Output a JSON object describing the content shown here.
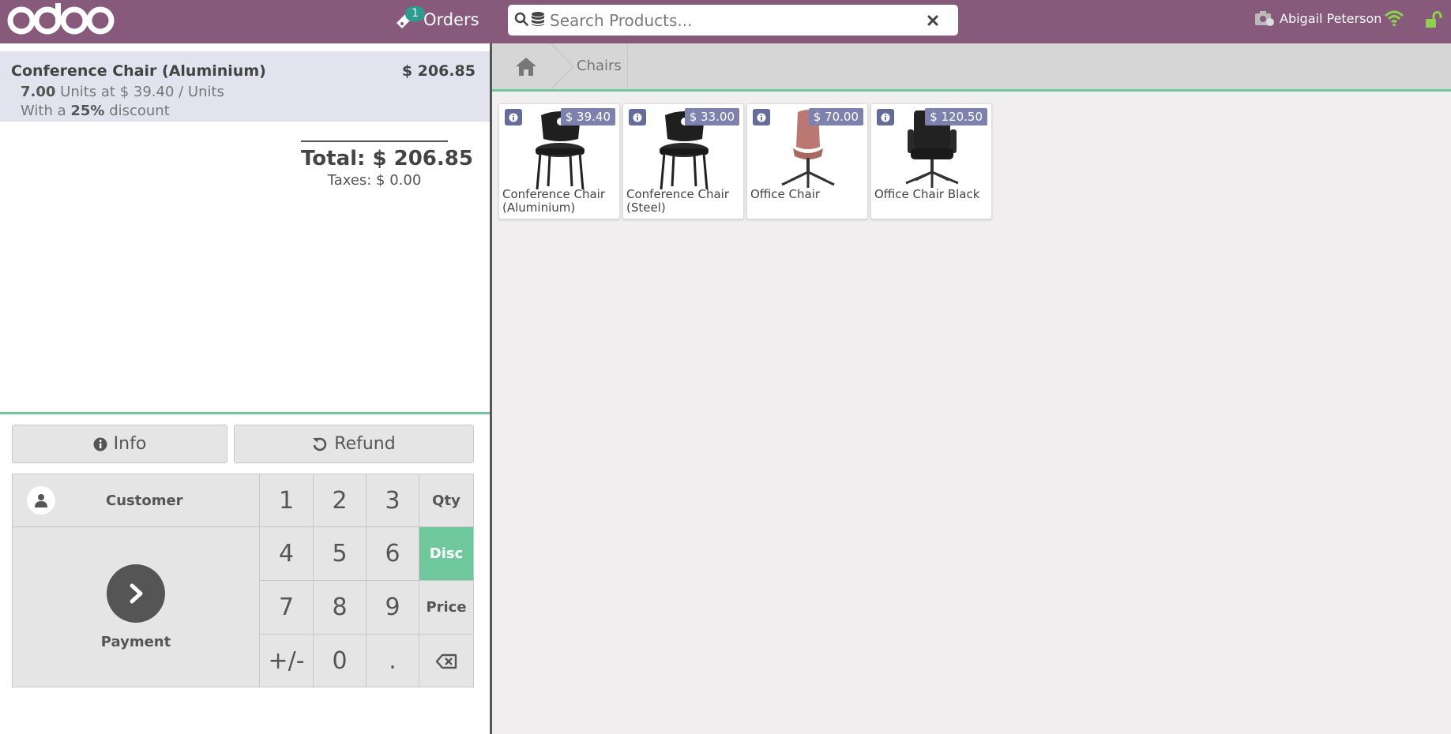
{
  "topbar": {
    "logo_text": "odoo",
    "orders_label": "Orders",
    "orders_count": "1",
    "search_placeholder": "Search Products...",
    "cashier_name": "Abigail Peterson"
  },
  "order": {
    "lines": [
      {
        "product": "Conference Chair (Aluminium)",
        "price": "$ 206.85",
        "quantity": "7.00",
        "unit_detail": "Units at $ 39.40 / Units",
        "discount_prefix": "With a",
        "discount_value": "25%",
        "discount_suffix": "discount"
      }
    ],
    "total_label": "Total: $ 206.85",
    "taxes_label": "Taxes: $ 0.00"
  },
  "controls": {
    "info_label": "Info",
    "refund_label": "Refund",
    "customer_label": "Customer",
    "payment_label": "Payment",
    "keys": [
      "1",
      "2",
      "3",
      "4",
      "5",
      "6",
      "7",
      "8",
      "9",
      "+/-",
      "0",
      "."
    ],
    "modes": [
      "Qty",
      "Disc",
      "Price"
    ],
    "active_mode": "Disc"
  },
  "breadcrumbs": {
    "category": "Chairs"
  },
  "products": [
    {
      "name": "Conference Chair (Aluminium)",
      "price": "$ 39.40"
    },
    {
      "name": "Conference Chair (Steel)",
      "price": "$ 33.00"
    },
    {
      "name": "Office Chair",
      "price": "$ 70.00"
    },
    {
      "name": "Office Chair Black",
      "price": "$ 120.50"
    }
  ],
  "colors": {
    "brand": "#875a7b",
    "accent": "#6ec89b",
    "price_tag": "#7c82ad",
    "badge": "#2e9b8f",
    "status_ok": "#8bd14a"
  }
}
